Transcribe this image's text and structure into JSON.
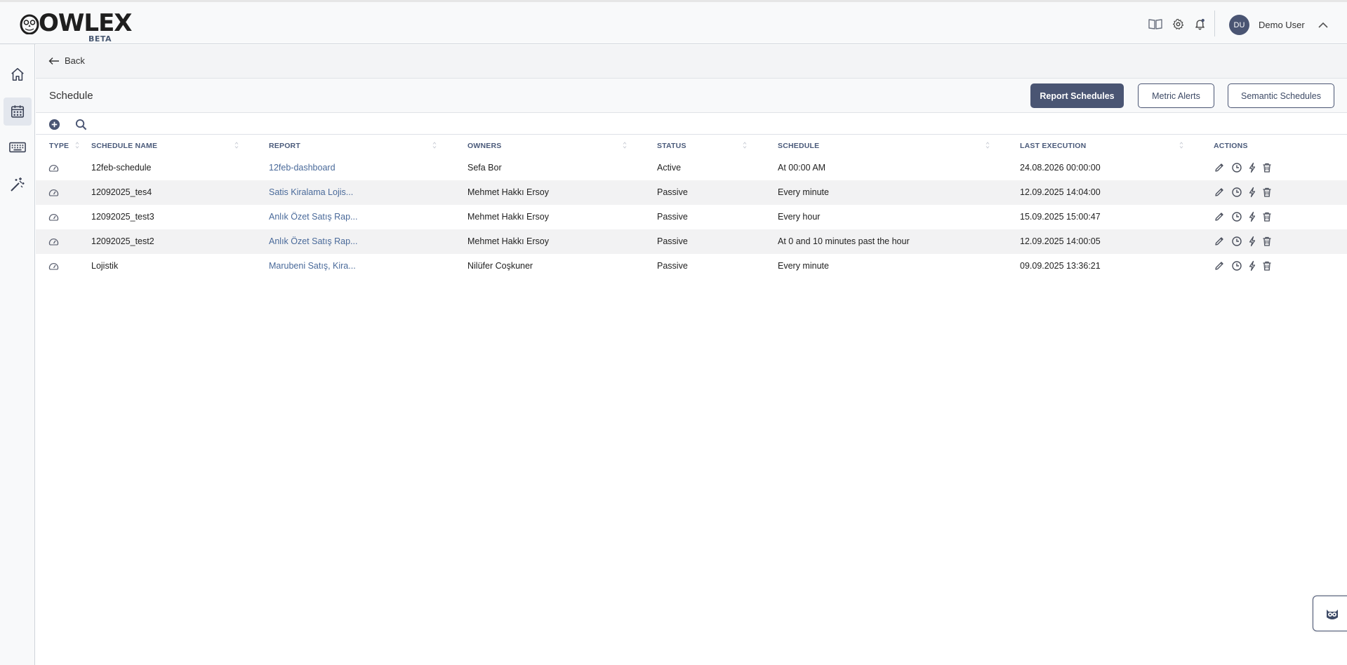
{
  "app": {
    "logo_text": "OWLEX",
    "logo_badge": "BETA"
  },
  "topbar": {
    "icons": [
      "book-icon",
      "gear-icon",
      "bell-icon"
    ],
    "user_initials": "DU",
    "user_name": "Demo User"
  },
  "sidebar": {
    "items": [
      {
        "name": "home-icon",
        "active": false
      },
      {
        "name": "calendar-icon",
        "active": true
      },
      {
        "name": "keyboard-icon",
        "active": false
      },
      {
        "name": "magic-wand-icon",
        "active": false
      }
    ]
  },
  "nav": {
    "back_label": "Back"
  },
  "header": {
    "title": "Schedule",
    "tabs": [
      {
        "label": "Report Schedules",
        "active": true
      },
      {
        "label": "Metric Alerts",
        "active": false
      },
      {
        "label": "Semantic Schedules",
        "active": false
      }
    ]
  },
  "toolbar": {
    "icons": [
      "add-icon",
      "search-icon"
    ]
  },
  "table": {
    "columns": [
      "TYPE",
      "SCHEDULE NAME",
      "REPORT",
      "OWNERS",
      "STATUS",
      "SCHEDULE",
      "LAST EXECUTION",
      "ACTIONS"
    ],
    "rows": [
      {
        "name": "12feb-schedule",
        "report": "12feb-dashboard",
        "owners": "Sefa Bor",
        "status": "Active",
        "schedule": "At 00:00 AM",
        "last_execution": "24.08.2026 00:00:00"
      },
      {
        "name": "12092025_tes4",
        "report": "Satis Kiralama Lojis...",
        "owners": "Mehmet Hakkı Ersoy",
        "status": "Passive",
        "schedule": "Every minute",
        "last_execution": "12.09.2025 14:04:00"
      },
      {
        "name": "12092025_test3",
        "report": "Anlık Özet Satış Rap...",
        "owners": "Mehmet Hakkı Ersoy",
        "status": "Passive",
        "schedule": "Every hour",
        "last_execution": "15.09.2025 15:00:47"
      },
      {
        "name": "12092025_test2",
        "report": "Anlık Özet Satış Rap...",
        "owners": "Mehmet Hakkı Ersoy",
        "status": "Passive",
        "schedule": "At 0 and 10 minutes past the hour",
        "last_execution": "12.09.2025 14:00:05"
      },
      {
        "name": "Lojistik",
        "report": "Marubeni Satış, Kira...",
        "owners": "Nilüfer Coşkuner",
        "status": "Passive",
        "schedule": "Every minute",
        "last_execution": "09.09.2025 13:36:21"
      }
    ],
    "row_actions": [
      "edit-icon",
      "history-icon",
      "run-now-icon",
      "delete-icon"
    ]
  },
  "colors": {
    "accent": "#4a5573",
    "link": "#4a6a9a",
    "header_text": "#4a5a7a",
    "alt_row": "#f2f2f3"
  }
}
